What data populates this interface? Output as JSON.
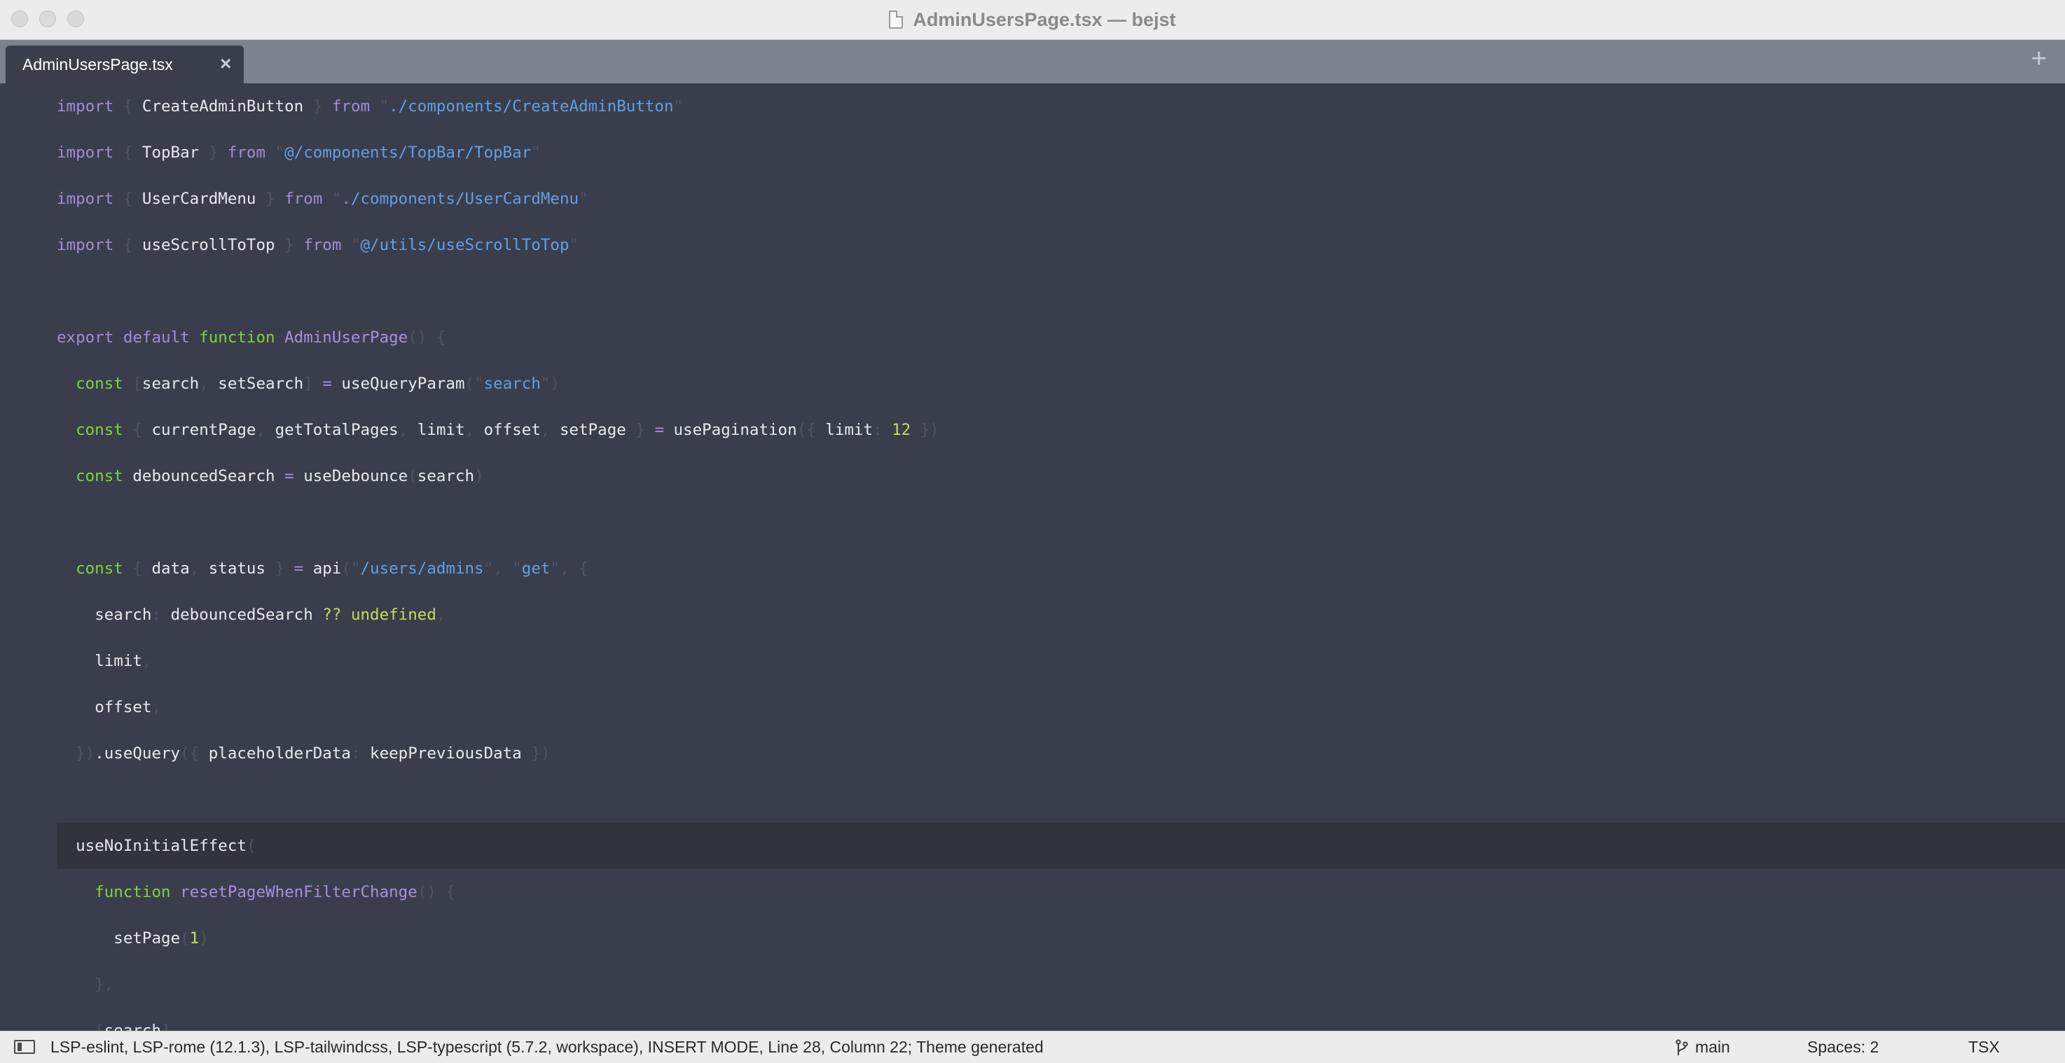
{
  "window": {
    "title": "AdminUsersPage.tsx — bejst"
  },
  "tabs": [
    {
      "label": "AdminUsersPage.tsx",
      "close_symbol": "×"
    }
  ],
  "tab_add_symbol": "+",
  "code_lines": [
    [
      [
        "kw",
        "import"
      ],
      [
        "pu",
        " { "
      ],
      [
        "df",
        "CreateAdminButton"
      ],
      [
        "pu",
        " } "
      ],
      [
        "kw",
        "from"
      ],
      [
        "pu",
        " \""
      ],
      [
        "st",
        "./components/CreateAdminButton"
      ],
      [
        "pu",
        "\""
      ]
    ],
    [
      [
        "kw",
        "import"
      ],
      [
        "pu",
        " { "
      ],
      [
        "df",
        "TopBar"
      ],
      [
        "pu",
        " } "
      ],
      [
        "kw",
        "from"
      ],
      [
        "pu",
        " \""
      ],
      [
        "st",
        "@/components/TopBar/TopBar"
      ],
      [
        "pu",
        "\""
      ]
    ],
    [
      [
        "kw",
        "import"
      ],
      [
        "pu",
        " { "
      ],
      [
        "df",
        "UserCardMenu"
      ],
      [
        "pu",
        " } "
      ],
      [
        "kw",
        "from"
      ],
      [
        "pu",
        " \""
      ],
      [
        "st",
        "./components/UserCardMenu"
      ],
      [
        "pu",
        "\""
      ]
    ],
    [
      [
        "kw",
        "import"
      ],
      [
        "pu",
        " { "
      ],
      [
        "df",
        "useScrollToTop"
      ],
      [
        "pu",
        " } "
      ],
      [
        "kw",
        "from"
      ],
      [
        "pu",
        " \""
      ],
      [
        "st",
        "@/utils/useScrollToTop"
      ],
      [
        "pu",
        "\""
      ]
    ],
    [],
    [
      [
        "kw",
        "export default "
      ],
      [
        "gr",
        "function"
      ],
      [
        "pu",
        " "
      ],
      [
        "fn",
        "AdminUserPage"
      ],
      [
        "pu",
        "() {"
      ]
    ],
    [
      [
        "pu",
        "  "
      ],
      [
        "gr",
        "const"
      ],
      [
        "pu",
        " ["
      ],
      [
        "df",
        "search"
      ],
      [
        "pu",
        ", "
      ],
      [
        "df",
        "setSearch"
      ],
      [
        "pu",
        "] "
      ],
      [
        "op",
        "="
      ],
      [
        "pu",
        " "
      ],
      [
        "df",
        "useQueryParam"
      ],
      [
        "pu",
        "(\""
      ],
      [
        "st",
        "search"
      ],
      [
        "pu",
        "\")"
      ]
    ],
    [
      [
        "pu",
        "  "
      ],
      [
        "gr",
        "const"
      ],
      [
        "pu",
        " { "
      ],
      [
        "df",
        "currentPage"
      ],
      [
        "pu",
        ", "
      ],
      [
        "df",
        "getTotalPages"
      ],
      [
        "pu",
        ", "
      ],
      [
        "df",
        "limit"
      ],
      [
        "pu",
        ", "
      ],
      [
        "df",
        "offset"
      ],
      [
        "pu",
        ", "
      ],
      [
        "df",
        "setPage"
      ],
      [
        "pu",
        " } "
      ],
      [
        "op",
        "="
      ],
      [
        "pu",
        " "
      ],
      [
        "df",
        "usePagination"
      ],
      [
        "pu",
        "({ "
      ],
      [
        "df",
        "limit"
      ],
      [
        "pu",
        ": "
      ],
      [
        "nm",
        "12"
      ],
      [
        "pu",
        " })"
      ]
    ],
    [
      [
        "pu",
        "  "
      ],
      [
        "gr",
        "const"
      ],
      [
        "pu",
        " "
      ],
      [
        "df",
        "debouncedSearch"
      ],
      [
        "pu",
        " "
      ],
      [
        "op",
        "="
      ],
      [
        "pu",
        " "
      ],
      [
        "df",
        "useDebounce"
      ],
      [
        "pu",
        "("
      ],
      [
        "df",
        "search"
      ],
      [
        "pu",
        ")"
      ]
    ],
    [],
    [
      [
        "pu",
        "  "
      ],
      [
        "gr",
        "const"
      ],
      [
        "pu",
        " { "
      ],
      [
        "df",
        "data"
      ],
      [
        "pu",
        ", "
      ],
      [
        "df",
        "status"
      ],
      [
        "pu",
        " } "
      ],
      [
        "op",
        "="
      ],
      [
        "pu",
        " "
      ],
      [
        "df",
        "api"
      ],
      [
        "pu",
        "(\""
      ],
      [
        "st",
        "/users/admins"
      ],
      [
        "pu",
        "\", \""
      ],
      [
        "st",
        "get"
      ],
      [
        "pu",
        "\", {"
      ]
    ],
    [
      [
        "pu",
        "    "
      ],
      [
        "df",
        "search"
      ],
      [
        "pu",
        ": "
      ],
      [
        "df",
        "debouncedSearch"
      ],
      [
        "pu",
        " "
      ],
      [
        "nm",
        "??"
      ],
      [
        "pu",
        " "
      ],
      [
        "nm",
        "undefined"
      ],
      [
        "pu",
        ","
      ]
    ],
    [
      [
        "pu",
        "    "
      ],
      [
        "df",
        "limit"
      ],
      [
        "pu",
        ","
      ]
    ],
    [
      [
        "pu",
        "    "
      ],
      [
        "df",
        "offset"
      ],
      [
        "pu",
        ","
      ]
    ],
    [
      [
        "pu",
        "  })"
      ],
      [
        "df",
        ".useQuery"
      ],
      [
        "pu",
        "({ "
      ],
      [
        "df",
        "placeholderData"
      ],
      [
        "pu",
        ": "
      ],
      [
        "df",
        "keepPreviousData"
      ],
      [
        "pu",
        " })"
      ]
    ],
    [],
    [
      [
        "pu",
        "  "
      ],
      [
        "df",
        "useNoInitialEffect"
      ],
      [
        "pu",
        "("
      ]
    ],
    [
      [
        "pu",
        "    "
      ],
      [
        "gr",
        "function"
      ],
      [
        "pu",
        " "
      ],
      [
        "fn",
        "resetPageWhenFilterChange"
      ],
      [
        "pu",
        "() {"
      ]
    ],
    [
      [
        "pu",
        "      "
      ],
      [
        "df",
        "setPage"
      ],
      [
        "pu",
        "("
      ],
      [
        "nm",
        "1"
      ],
      [
        "pu",
        ")"
      ]
    ],
    [
      [
        "pu",
        "    },"
      ]
    ],
    [
      [
        "pu",
        "    ["
      ],
      [
        "df",
        "search"
      ],
      [
        "pu",
        "],"
      ]
    ]
  ],
  "active_line_index": 16,
  "status": {
    "info": "LSP-eslint, LSP-rome (12.1.3), LSP-tailwindcss, LSP-typescript (5.7.2, workspace), INSERT MODE, Line 28, Column 22; Theme generated",
    "branch": "main",
    "spaces": "Spaces: 2",
    "syntax": "TSX"
  },
  "colors": {
    "editor_bg": "#3a3e4c",
    "tabbar_bg": "#7e8290",
    "keyword": "#a48ad8",
    "string": "#5f9fe6",
    "storage": "#7fd33d",
    "number": "#c5dc56"
  },
  "icons": {
    "file": "document-icon",
    "branch": "git-branch-icon",
    "sidebar": "sidebar-toggle-icon"
  }
}
